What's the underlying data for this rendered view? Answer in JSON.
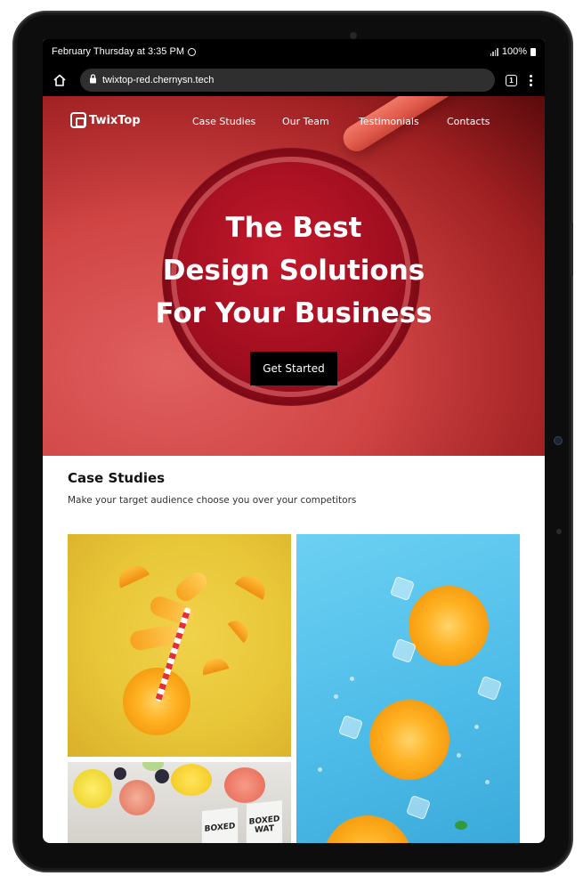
{
  "status_bar": {
    "datetime": "February Thursday at 3:35 PM",
    "battery": "100%"
  },
  "browser": {
    "url": "twixtop-red.chernysn.tech",
    "tab_count": "1"
  },
  "site": {
    "logo_text": "TwixTop",
    "nav": [
      "Case Studies",
      "Our Team",
      "Testimonials",
      "Contacts"
    ],
    "hero_lines": [
      "The Best",
      "Design Solutions",
      "For Your Business"
    ],
    "cta_label": "Get Started",
    "section_title": "Case Studies",
    "section_subtitle": "Make your target audience choose you over your competitors",
    "carton_text": [
      "BOXED",
      "BOXED WAT"
    ]
  },
  "colors": {
    "accent_red": "#c21a2c",
    "button_black": "#000000"
  }
}
